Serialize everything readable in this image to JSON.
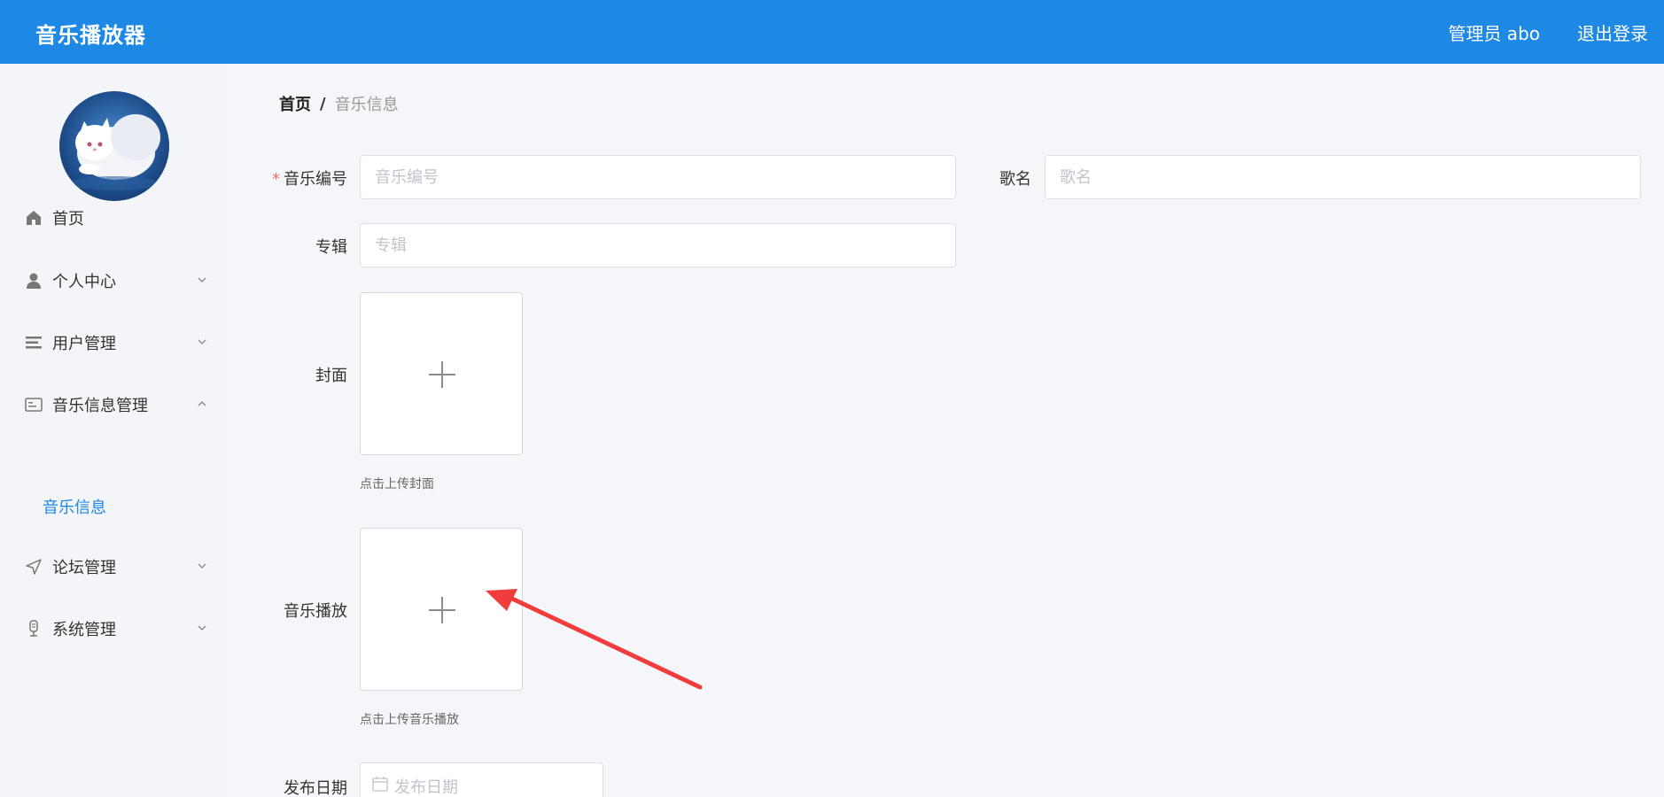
{
  "header": {
    "app_title": "音乐播放器",
    "user_label": "管理员 abo",
    "logout_label": "退出登录"
  },
  "sidebar": {
    "items": [
      {
        "label": "首页",
        "icon": "home-icon"
      },
      {
        "label": "个人中心",
        "icon": "user-icon"
      },
      {
        "label": "用户管理",
        "icon": "list-icon"
      },
      {
        "label": "音乐信息管理",
        "icon": "card-icon"
      },
      {
        "label": "论坛管理",
        "icon": "send-icon"
      },
      {
        "label": "系统管理",
        "icon": "mic-icon"
      }
    ],
    "sub_item": "音乐信息"
  },
  "breadcrumb": {
    "home": "首页",
    "separator": "/",
    "current": "音乐信息"
  },
  "form": {
    "music_no_label": "音乐编号",
    "music_no_placeholder": "音乐编号",
    "song_label": "歌名",
    "song_placeholder": "歌名",
    "album_label": "专辑",
    "album_placeholder": "专辑",
    "cover_label": "封面",
    "cover_hint": "点击上传封面",
    "play_label": "音乐播放",
    "play_hint": "点击上传音乐播放",
    "date_label": "发布日期",
    "date_placeholder": "发布日期"
  },
  "colors": {
    "brand": "#1e88e5",
    "required": "#f56c6c",
    "annotation_arrow": "#f03c3c"
  }
}
